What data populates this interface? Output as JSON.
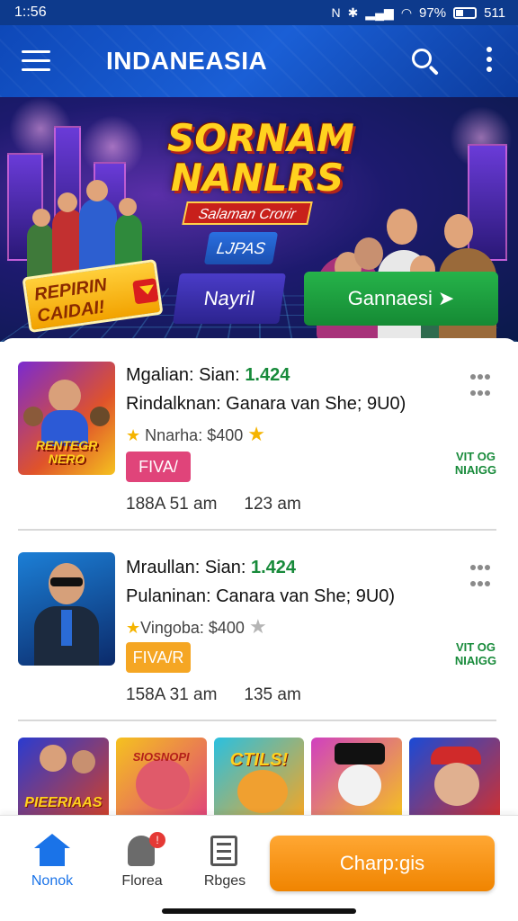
{
  "status_bar": {
    "time": "1::56",
    "battery_percent": "97%",
    "signal_text": "511"
  },
  "app_bar": {
    "title": "INDANEASIA"
  },
  "banner": {
    "title_line1": "SORNAM",
    "title_line2": "NANLRS",
    "subtitle": "Salaman Crorir",
    "chip": "LJPAS",
    "promo_line1": "REPIRIN",
    "promo_line2": "CAIDAI!",
    "button_purple": "Nayril",
    "button_green": "Gannaesi"
  },
  "cards": [
    {
      "line1_label": "Mgalian: Sian:",
      "line1_value": "1.424",
      "line2": "Rindalknan: Ganara van She; 9U0)",
      "rating_text": "Nnarha: $400",
      "badge": "FIVA/",
      "side_label": "VIT OG NIAIGG",
      "meta1": "188A 51 am",
      "meta2": "123 am",
      "thumb_text": "RENTEGR NERO"
    },
    {
      "line1_label": "Mraullan: Sian:",
      "line1_value": "1.424",
      "line2": "Pulaninan: Canara van She; 9U0)",
      "rating_text": "Vingoba: $400",
      "badge": "FIVA/R",
      "side_label": "VIT OG NIAIGG",
      "meta1": "158A 31 am",
      "meta2": "135 am"
    }
  ],
  "thumbs": [
    {
      "label": "PIEERIAAS"
    },
    {
      "label": "SIOSNOPI"
    },
    {
      "label": "CTILS!"
    },
    {
      "label": ""
    },
    {
      "label": ""
    }
  ],
  "bottom_nav": {
    "home": "Nonok",
    "notifications": "Florea",
    "pages": "Rbges",
    "notification_badge": "!",
    "cta": "Charp:gis"
  },
  "colors": {
    "primary": "#1a5fd6",
    "accent_green": "#178a3a",
    "cta_orange": "#f59a1a",
    "badge_pink": "#e0447a",
    "badge_orange": "#f5a623"
  }
}
